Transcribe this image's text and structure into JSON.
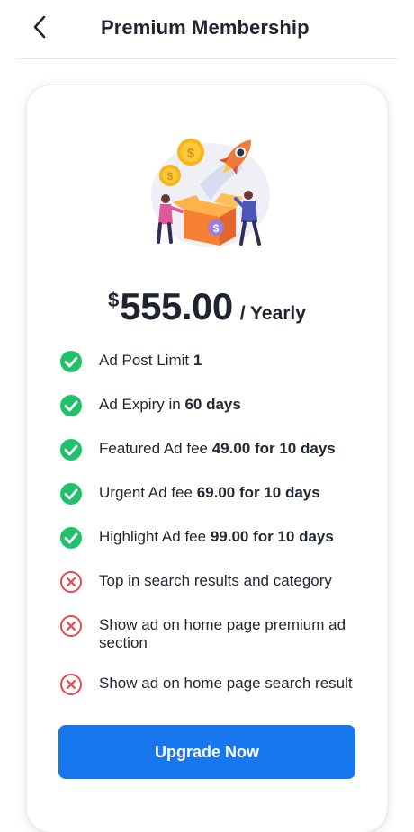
{
  "header": {
    "back_icon": "chevron-left-icon",
    "title": "Premium Membership"
  },
  "illustration": {
    "name": "rocket-coins-gift-illustration",
    "coin_symbol": "$"
  },
  "pricing": {
    "currency": "$",
    "amount": "555.00",
    "period": "/ Yearly"
  },
  "features": [
    {
      "text": "Ad Post Limit ",
      "bold": "1",
      "included": true
    },
    {
      "text": "Ad Expiry in ",
      "bold": "60 days",
      "included": true
    },
    {
      "text": "Featured Ad fee ",
      "bold": "49.00 for 10 days",
      "included": true
    },
    {
      "text": "Urgent Ad fee ",
      "bold": "69.00 for 10 days",
      "included": true
    },
    {
      "text": "Highlight Ad fee ",
      "bold": "99.00 for 10 days",
      "included": true
    },
    {
      "text": "Top in search results and category",
      "bold": "",
      "included": false
    },
    {
      "text": "Show ad on home page premium ad section",
      "bold": "",
      "included": false
    },
    {
      "text": "Show ad on home page search result",
      "bold": "",
      "included": false
    }
  ],
  "cta": {
    "label": "Upgrade Now"
  },
  "colors": {
    "accent": "#1677ee",
    "included": "#21c16b",
    "excluded": "#e5484d"
  }
}
